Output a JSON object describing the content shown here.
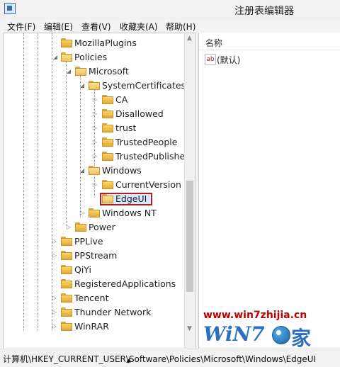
{
  "window": {
    "title": "注册表编辑器"
  },
  "menu": [
    {
      "label": "文件(F)"
    },
    {
      "label": "编辑(E)"
    },
    {
      "label": "查看(V)"
    },
    {
      "label": "收藏夹(A)"
    },
    {
      "label": "帮助(H)"
    }
  ],
  "tree": {
    "items": [
      {
        "label": "MozillaPlugins",
        "expander": ""
      },
      {
        "label": "Policies",
        "expander": "◢"
      },
      {
        "label": "Microsoft",
        "expander": "◢"
      },
      {
        "label": "SystemCertificates",
        "expander": "◢"
      },
      {
        "label": "CA",
        "expander": "▷"
      },
      {
        "label": "Disallowed",
        "expander": "▷"
      },
      {
        "label": "trust",
        "expander": "▷"
      },
      {
        "label": "TrustedPeople",
        "expander": "▷"
      },
      {
        "label": "TrustedPublisher",
        "expander": "▷"
      },
      {
        "label": "Windows",
        "expander": "◢"
      },
      {
        "label": "CurrentVersion",
        "expander": "▷"
      },
      {
        "label": "EdgeUI",
        "expander": ""
      },
      {
        "label": "Windows NT",
        "expander": "▷"
      },
      {
        "label": "Power",
        "expander": "▷"
      },
      {
        "label": "PPLive",
        "expander": "▷"
      },
      {
        "label": "PPStream",
        "expander": "▷"
      },
      {
        "label": "QiYi",
        "expander": ""
      },
      {
        "label": "RegisteredApplications",
        "expander": ""
      },
      {
        "label": "Tencent",
        "expander": "▷"
      },
      {
        "label": "Thunder Network",
        "expander": "▷"
      },
      {
        "label": "WinRAR",
        "expander": "▷"
      }
    ]
  },
  "values": {
    "column_name": "名称",
    "icon_text": "ab",
    "entries": [
      {
        "name": "(默认)"
      }
    ]
  },
  "watermark": {
    "url": "www.win7zhijia.cn",
    "logo_text": "WiN7",
    "logo_suffix": "家"
  },
  "status": {
    "path": "计算机\\HKEY_CURRENT_USER\\Software\\Policies\\Microsoft\\Windows\\EdgeUI"
  }
}
